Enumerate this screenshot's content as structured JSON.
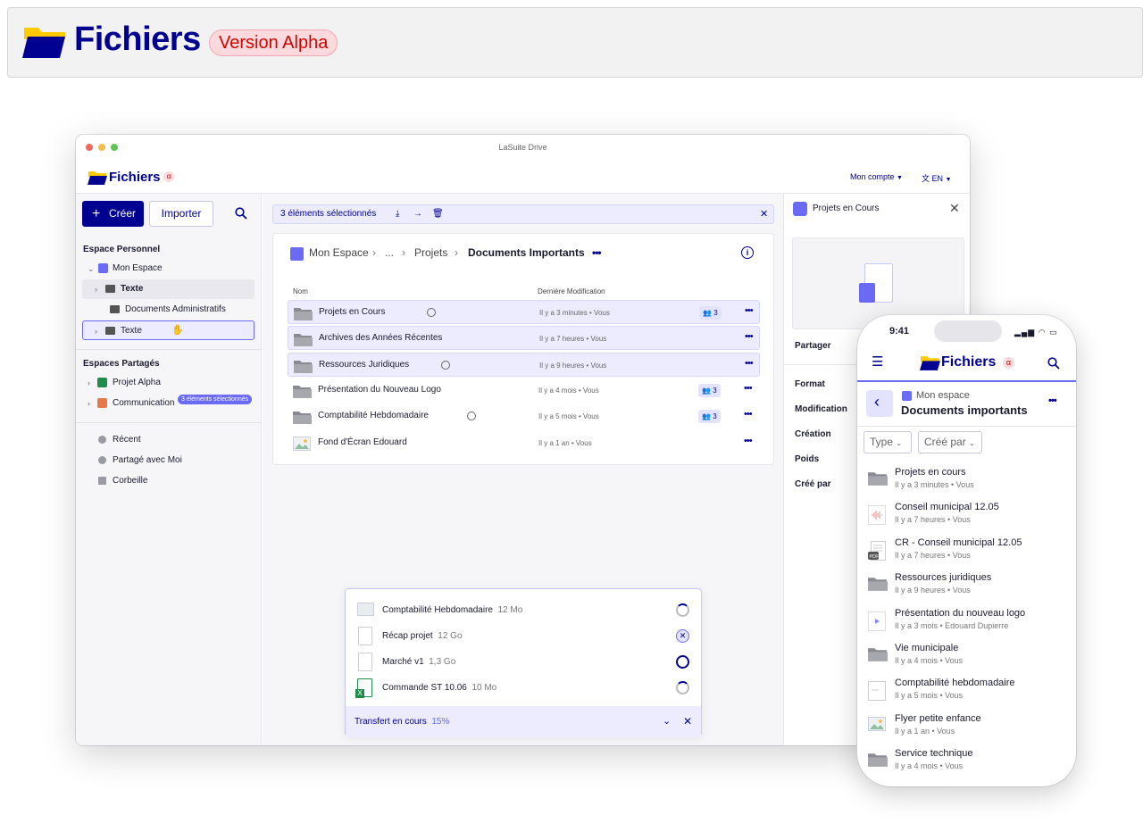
{
  "banner": {
    "title": "Fichiers",
    "badge": "Version Alpha"
  },
  "window": {
    "title": "LaSuite Drive"
  },
  "app": {
    "title": "Fichiers",
    "alpha": "α",
    "account": "Mon compte",
    "lang": "EN"
  },
  "sidebar": {
    "create": "Créer",
    "import": "Importer",
    "personal_title": "Espace Personnel",
    "personal": [
      {
        "label": "Mon Espace"
      },
      {
        "label": "Texte"
      },
      {
        "label": "Documents Administratifs"
      },
      {
        "label": "Texte"
      }
    ],
    "tooltip": "3 éléments sélectionnés",
    "shared_title": "Espaces Partagés",
    "shared": [
      {
        "label": "Projet Alpha",
        "color": "#1f8d49"
      },
      {
        "label": "Communication",
        "color": "#e4794a"
      }
    ],
    "nav": [
      {
        "label": "Récent"
      },
      {
        "label": "Partagé avec Moi"
      },
      {
        "label": "Corbeille"
      }
    ]
  },
  "selection": {
    "label": "3 éléments sélectionnés"
  },
  "breadcrumb": [
    "Mon Espace",
    "...",
    "Projets",
    "Documents Importants"
  ],
  "table": {
    "col_name": "Nom",
    "col_modified": "Dernière Modification",
    "rows": [
      {
        "name": "Projets en Cours",
        "date": "Il y a 3 minutes • Vous",
        "shares": "3",
        "selected": true,
        "type": "folder"
      },
      {
        "name": "Archives des Années Récentes",
        "date": "Il y a 7 heures • Vous",
        "shares": "",
        "selected": true,
        "type": "folder"
      },
      {
        "name": "Ressources Juridiques",
        "date": "Il y a 9 heures • Vous",
        "shares": "",
        "selected": true,
        "type": "folder"
      },
      {
        "name": "Présentation du Nouveau Logo",
        "date": "Il y a 4 mois • Vous",
        "shares": "3",
        "selected": false,
        "type": "folder"
      },
      {
        "name": "Comptabilité Hebdomadaire",
        "date": "Il y a 5 mois • Vous",
        "shares": "3",
        "selected": false,
        "type": "folder"
      },
      {
        "name": "Fond d'Écran Edouard",
        "date": "Il y a 1 an • Vous",
        "shares": "",
        "selected": false,
        "type": "image"
      }
    ]
  },
  "uploads": {
    "items": [
      {
        "name": "Comptabilité Hebdomadaire",
        "size": "12 Mo"
      },
      {
        "name": "Récap projet",
        "size": "12 Go"
      },
      {
        "name": "Marché v1",
        "size": "1,3 Go"
      },
      {
        "name": "Commande ST 10.06",
        "size": "10 Mo"
      }
    ],
    "status": "Transfert en cours",
    "percent": "15%"
  },
  "details": {
    "title": "Projets en Cours",
    "share": "Partager",
    "labels": [
      "Format",
      "Modification",
      "Création",
      "Poids",
      "Créé par"
    ]
  },
  "phone": {
    "time": "9:41",
    "title": "Fichiers",
    "alpha": "α",
    "space": "Mon espace",
    "folder": "Documents importants",
    "filter_type": "Type",
    "filter_by": "Créé par",
    "items": [
      {
        "name": "Projets en cours",
        "date": "Il y a 3 minutes • Vous",
        "icon": "folder"
      },
      {
        "name": "Conseil municipal 12.05",
        "date": "Il y a 7 heures • Vous",
        "icon": "audio"
      },
      {
        "name": "CR - Conseil municipal 12.05",
        "date": "Il y a 7 heures • Vous",
        "icon": "pdf"
      },
      {
        "name": "Ressources juridiques",
        "date": "Il y a 9 heures • Vous",
        "icon": "folder"
      },
      {
        "name": "Présentation du nouveau logo",
        "date": "Il y a 3 mois • Edouard Dupierre",
        "icon": "video"
      },
      {
        "name": "Vie municipale",
        "date": "Il y a 4 mois • Vous",
        "icon": "folder"
      },
      {
        "name": "Comptabilité hebdomadaire",
        "date": "Il y a 5 mois • Vous",
        "icon": "doc"
      },
      {
        "name": "Flyer petite enfance",
        "date": "Il y a 1 an • Vous",
        "icon": "image"
      },
      {
        "name": "Service technique",
        "date": "Il y a 4 mois • Vous",
        "icon": "folder"
      }
    ]
  },
  "colors": {
    "primary": "#000091",
    "accent": "#6a6af4",
    "alpha_red": "#ce0500"
  }
}
